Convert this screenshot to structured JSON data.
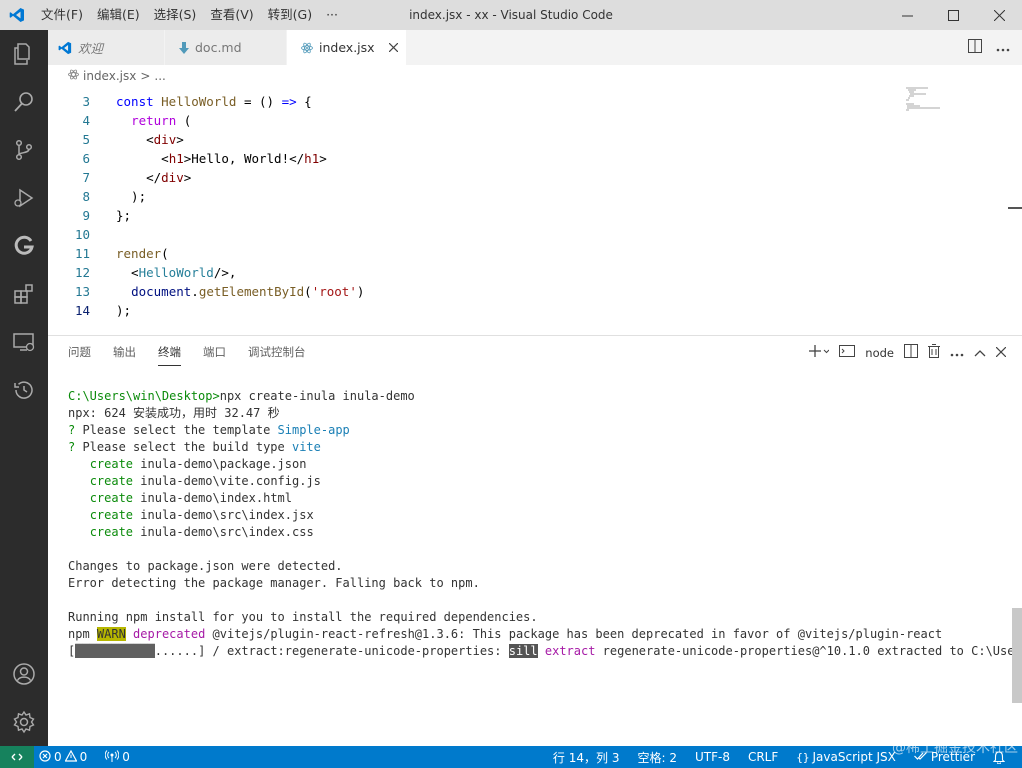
{
  "window": {
    "title": "index.jsx - xx - Visual Studio Code",
    "menu": [
      "文件(F)",
      "编辑(E)",
      "选择(S)",
      "查看(V)",
      "转到(G)",
      "···"
    ]
  },
  "tabs": [
    {
      "label": "欢迎",
      "icon": "vscode-logo-icon",
      "active": false,
      "italic": true
    },
    {
      "label": "doc.md",
      "icon": "markdown-icon",
      "active": false
    },
    {
      "label": "index.jsx",
      "icon": "react-icon",
      "active": true
    }
  ],
  "breadcrumb": {
    "file": "index.jsx",
    "sep": ">",
    "rest": "..."
  },
  "editor": {
    "lines": [
      {
        "n": "3",
        "segs": [
          [
            "kw",
            "const "
          ],
          [
            "fn",
            "HelloWorld"
          ],
          [
            "pl",
            " = () "
          ],
          [
            "kw",
            "=>"
          ],
          [
            "pl",
            " {"
          ]
        ]
      },
      {
        "n": "4",
        "segs": [
          [
            "pl",
            "  "
          ],
          [
            "kw2",
            "return"
          ],
          [
            "pl",
            " ("
          ]
        ]
      },
      {
        "n": "5",
        "segs": [
          [
            "pl",
            "    "
          ],
          [
            "pl",
            "<"
          ],
          [
            "tg",
            "div"
          ],
          [
            "pl",
            ">"
          ]
        ]
      },
      {
        "n": "6",
        "segs": [
          [
            "pl",
            "      <"
          ],
          [
            "tg",
            "h1"
          ],
          [
            "pl",
            ">Hello, World!</"
          ],
          [
            "tg",
            "h1"
          ],
          [
            "pl",
            ">"
          ]
        ]
      },
      {
        "n": "7",
        "segs": [
          [
            "pl",
            "    </"
          ],
          [
            "tg",
            "div"
          ],
          [
            "pl",
            ">"
          ]
        ]
      },
      {
        "n": "8",
        "segs": [
          [
            "pl",
            "  );"
          ]
        ]
      },
      {
        "n": "9",
        "segs": [
          [
            "pl",
            "};"
          ]
        ]
      },
      {
        "n": "10",
        "segs": []
      },
      {
        "n": "11",
        "segs": [
          [
            "fn",
            "render"
          ],
          [
            "pl",
            "("
          ]
        ]
      },
      {
        "n": "12",
        "segs": [
          [
            "pl",
            "  <"
          ],
          [
            "cm",
            "HelloWorld"
          ],
          [
            "pl",
            "/>,"
          ]
        ]
      },
      {
        "n": "13",
        "segs": [
          [
            "pl",
            "  "
          ],
          [
            "vr",
            "document"
          ],
          [
            "pl",
            "."
          ],
          [
            "fn",
            "getElementById"
          ],
          [
            "pl",
            "("
          ],
          [
            "st",
            "'root'"
          ],
          [
            "pl",
            ")"
          ]
        ]
      },
      {
        "n": "14",
        "segs": [
          [
            "pl",
            ");"
          ]
        ],
        "current": true
      }
    ]
  },
  "panel": {
    "tabs": [
      "问题",
      "输出",
      "终端",
      "端口",
      "调试控制台"
    ],
    "active_tab": "终端",
    "terminal_label": "node"
  },
  "terminal": {
    "lines": [
      [
        [
          "t-prompt",
          "C:\\Users\\win\\Desktop>"
        ],
        [
          "",
          "npx create-inula inula-demo"
        ]
      ],
      [
        [
          "",
          "npx: 624 安装成功，用时 32.47 秒"
        ]
      ],
      [
        [
          "t-q",
          "? "
        ],
        [
          "",
          "Please select the template "
        ],
        [
          "t-ans",
          "Simple-app"
        ]
      ],
      [
        [
          "t-q",
          "? "
        ],
        [
          "",
          "Please select the build type "
        ],
        [
          "t-ans",
          "vite"
        ]
      ],
      [
        [
          "",
          "   "
        ],
        [
          "t-create",
          "create"
        ],
        [
          "",
          " inula-demo\\package.json"
        ]
      ],
      [
        [
          "",
          "   "
        ],
        [
          "t-create",
          "create"
        ],
        [
          "",
          " inula-demo\\vite.config.js"
        ]
      ],
      [
        [
          "",
          "   "
        ],
        [
          "t-create",
          "create"
        ],
        [
          "",
          " inula-demo\\index.html"
        ]
      ],
      [
        [
          "",
          "   "
        ],
        [
          "t-create",
          "create"
        ],
        [
          "",
          " inula-demo\\src\\index.jsx"
        ]
      ],
      [
        [
          "",
          "   "
        ],
        [
          "t-create",
          "create"
        ],
        [
          "",
          " inula-demo\\src\\index.css"
        ]
      ],
      [],
      [
        [
          "",
          "Changes to package.json were detected."
        ]
      ],
      [
        [
          "",
          "Error detecting the package manager. Falling back to npm."
        ]
      ],
      [],
      [
        [
          "",
          "Running npm install for you to install the required dependencies."
        ]
      ],
      [
        [
          "",
          "npm "
        ],
        [
          "t-warn",
          "WARN"
        ],
        [
          "",
          " "
        ],
        [
          "t-dep",
          "deprecated"
        ],
        [
          "",
          " @vitejs/plugin-react-refresh@1.3.6: This package has been deprecated in favor of @vitejs/plugin-react"
        ]
      ],
      [
        [
          "",
          "["
        ],
        [
          "t-bar",
          "███████████"
        ],
        [
          "",
          "......] / extract:regenerate-unicode-properties: "
        ],
        [
          "t-sill",
          "sill"
        ],
        [
          "",
          " "
        ],
        [
          "t-extract",
          "extract"
        ],
        [
          "",
          " regenerate-unicode-properties@^10.1.0 extracted to C:\\Use"
        ]
      ]
    ]
  },
  "statusbar": {
    "errors": "0",
    "warnings": "0",
    "ports": "0",
    "position": "行 14，列 3",
    "spaces": "空格: 2",
    "encoding": "UTF-8",
    "eol": "CRLF",
    "language": "JavaScript JSX",
    "formatter": "Prettier"
  },
  "watermark": "@稀土掘金技术社区",
  "colors": {
    "accent": "#007acc",
    "activity_bar": "#2c2c2c",
    "remote": "#16825d"
  }
}
